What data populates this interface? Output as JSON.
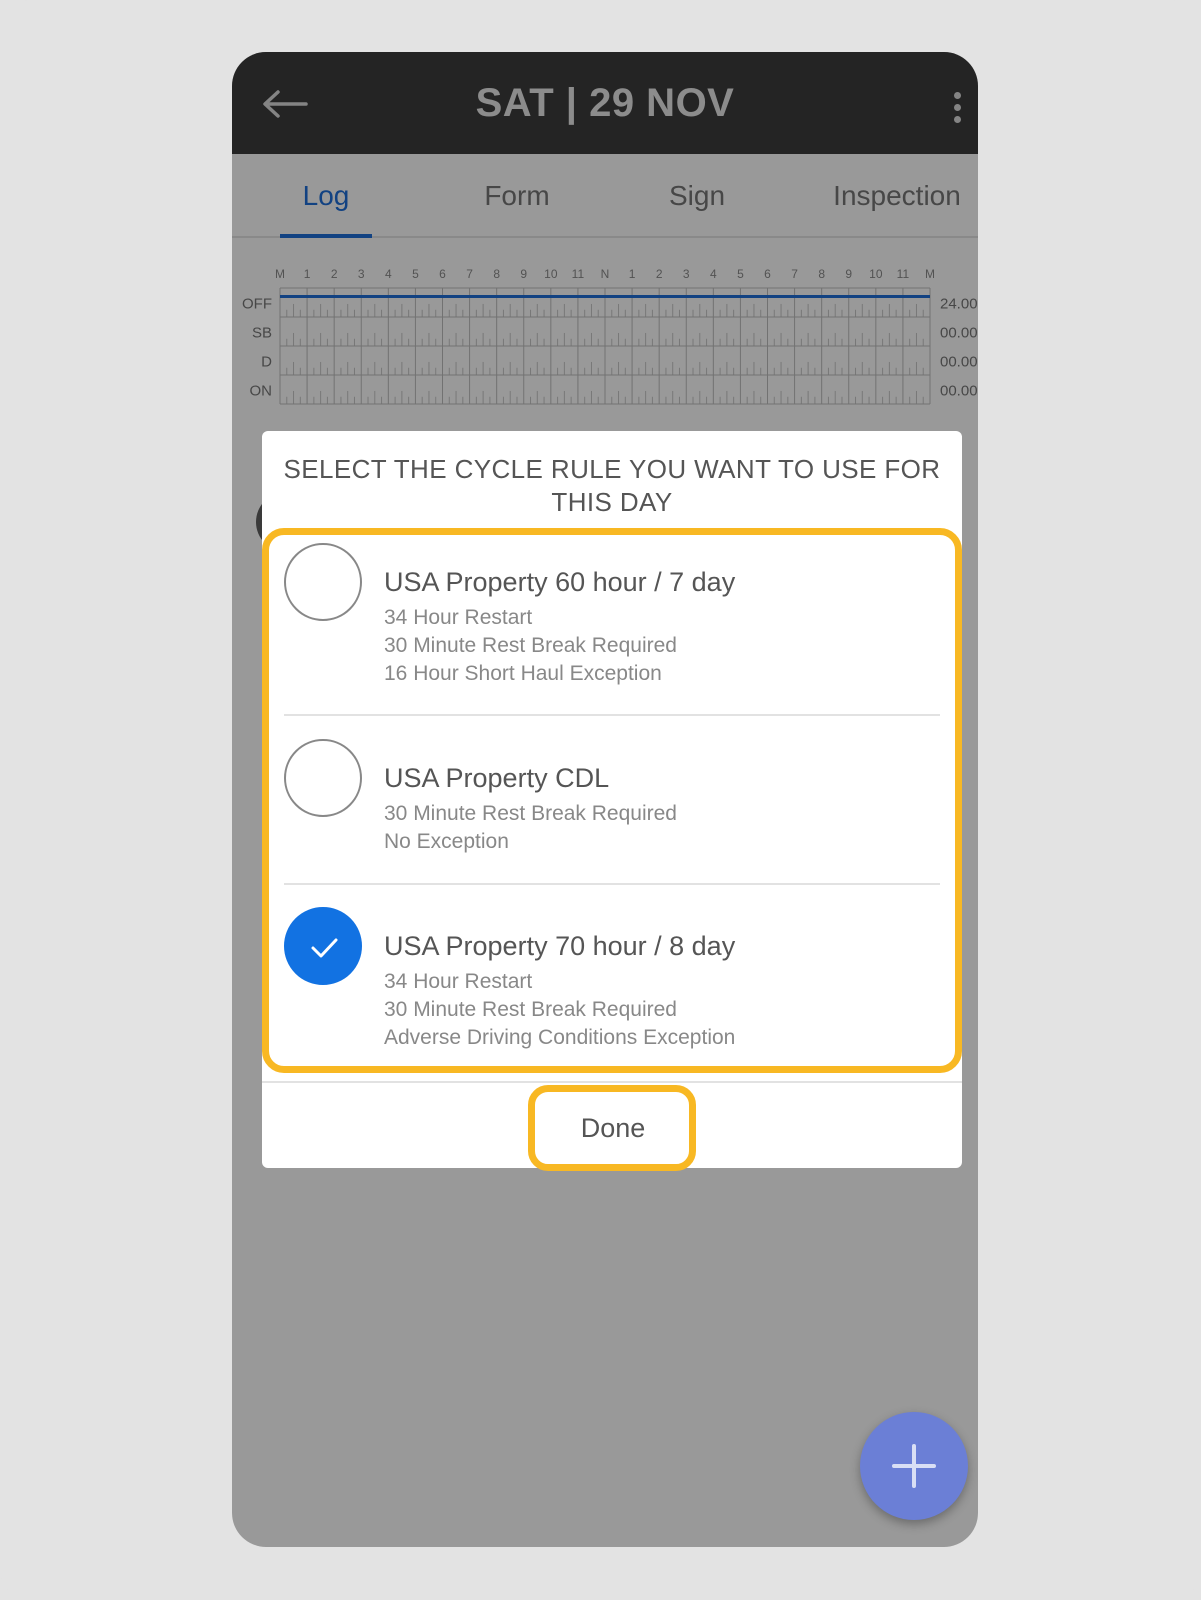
{
  "appbar": {
    "title": "SAT | 29 NOV"
  },
  "tabs": [
    {
      "label": "Log",
      "active": true
    },
    {
      "label": "Form",
      "active": false
    },
    {
      "label": "Sign",
      "active": false
    },
    {
      "label": "Inspection",
      "active": false
    }
  ],
  "log_grid": {
    "hours": [
      "M",
      "1",
      "2",
      "3",
      "4",
      "5",
      "6",
      "7",
      "8",
      "9",
      "10",
      "11",
      "N",
      "1",
      "2",
      "3",
      "4",
      "5",
      "6",
      "7",
      "8",
      "9",
      "10",
      "11",
      "M"
    ],
    "rows": [
      {
        "label": "OFF",
        "total": "24.00"
      },
      {
        "label": "SB",
        "total": "00.00"
      },
      {
        "label": "D",
        "total": "00.00"
      },
      {
        "label": "ON",
        "total": "00.00"
      }
    ],
    "line_color": "#1e6fd9"
  },
  "dialog": {
    "title": "SELECT THE CYCLE RULE YOU WANT TO USE FOR THIS DAY",
    "options": [
      {
        "title": "USA Property 60 hour / 7 day",
        "details": [
          "34 Hour Restart",
          "30 Minute Rest Break Required",
          "16 Hour Short Haul Exception"
        ],
        "selected": false
      },
      {
        "title": "USA Property CDL",
        "details": [
          "30 Minute Rest Break Required",
          "No Exception"
        ],
        "selected": false
      },
      {
        "title": "USA Property 70 hour / 8 day",
        "details": [
          "34 Hour Restart",
          "30 Minute Rest Break Required",
          "Adverse Driving Conditions Exception"
        ],
        "selected": true
      }
    ],
    "done_label": "Done"
  },
  "colors": {
    "highlight": "#f8b823",
    "accent": "#1272e2",
    "appbar": "#3d3d3d",
    "fab": "#6b7fd6"
  },
  "icons": {
    "back": "back-arrow-icon",
    "more": "more-vertical-icon",
    "check": "check-icon",
    "fab": "plus-icon"
  }
}
